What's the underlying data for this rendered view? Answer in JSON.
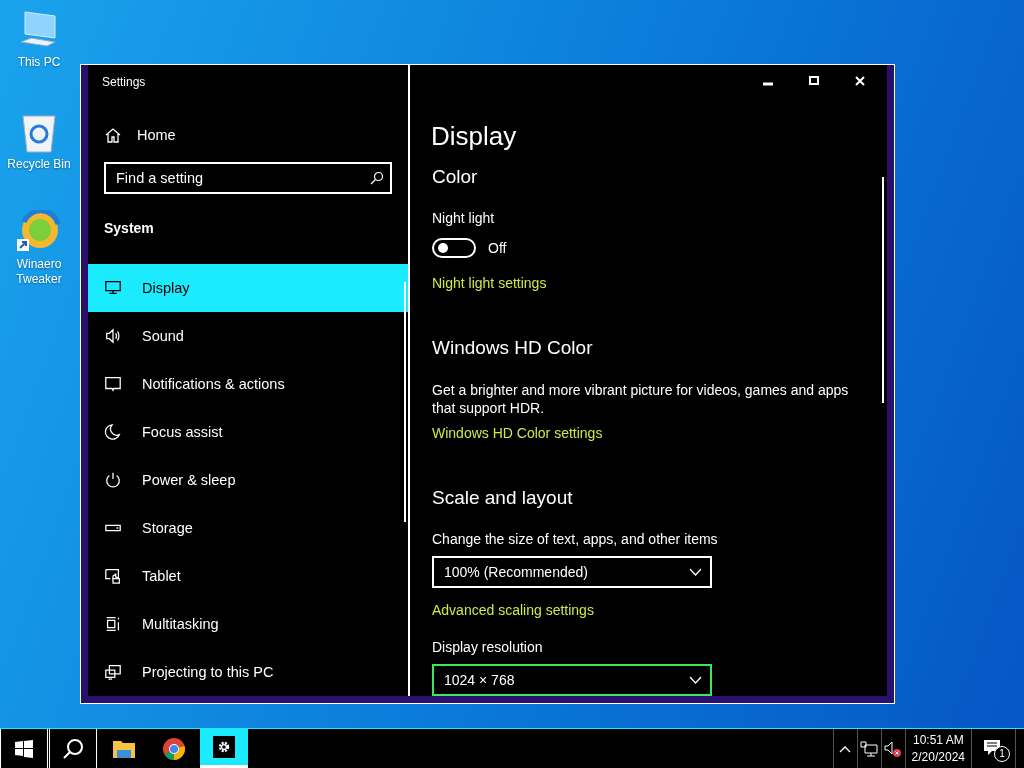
{
  "desktop_icons": [
    {
      "kind": "pc",
      "label": "This PC"
    },
    {
      "kind": "bin",
      "label": "Recycle Bin"
    },
    {
      "kind": "app",
      "label": "Winaero Tweaker"
    }
  ],
  "window": {
    "title": "Settings"
  },
  "sidebar": {
    "home": "Home",
    "search": {
      "placeholder": "Find a setting"
    },
    "section": "System",
    "items": [
      {
        "label": "Display",
        "selected": true
      },
      {
        "label": "Sound",
        "selected": false
      },
      {
        "label": "Notifications & actions",
        "selected": false
      },
      {
        "label": "Focus assist",
        "selected": false
      },
      {
        "label": "Power & sleep",
        "selected": false
      },
      {
        "label": "Storage",
        "selected": false
      },
      {
        "label": "Tablet",
        "selected": false
      },
      {
        "label": "Multitasking",
        "selected": false
      },
      {
        "label": "Projecting to this PC",
        "selected": false
      }
    ]
  },
  "content": {
    "title": "Display",
    "blocks": [
      {
        "kind": "heading",
        "text": "Color"
      },
      {
        "kind": "label",
        "text": "Night light"
      },
      {
        "kind": "toggle",
        "on": false,
        "text": "Off"
      },
      {
        "kind": "link",
        "text": "Night light settings"
      },
      {
        "kind": "heading",
        "text": "Windows HD Color"
      },
      {
        "kind": "paragraph",
        "text": "Get a brighter and more vibrant picture for videos, games and apps that support HDR."
      },
      {
        "kind": "link",
        "text": "Windows HD Color settings"
      },
      {
        "kind": "heading",
        "text": "Scale and layout"
      },
      {
        "kind": "label",
        "text": "Change the size of text, apps, and other items"
      },
      {
        "kind": "dropdown",
        "value": "100% (Recommended)",
        "highlighted": false
      },
      {
        "kind": "link",
        "text": "Advanced scaling settings"
      },
      {
        "kind": "label",
        "text": "Display resolution"
      },
      {
        "kind": "dropdown",
        "value": "1024 × 768",
        "highlighted": true
      }
    ]
  },
  "taskbar": {
    "apps": [
      {
        "kind": "explorer",
        "selected": false
      },
      {
        "kind": "browser",
        "selected": false
      },
      {
        "kind": "settings",
        "selected": true
      }
    ],
    "time": "10:51 AM",
    "date": "2/20/2024",
    "notifications": "1"
  }
}
